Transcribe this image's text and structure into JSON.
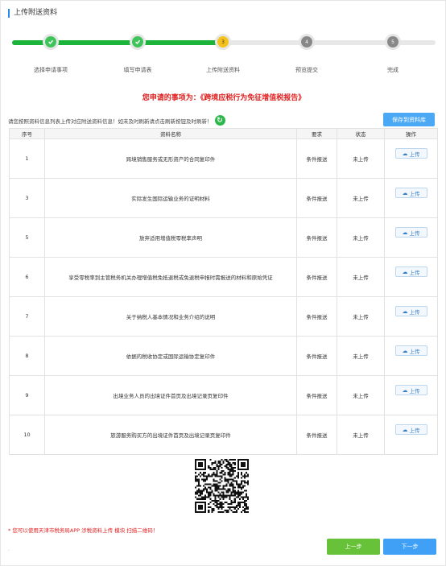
{
  "page": {
    "title": "上传附送资料"
  },
  "steps": [
    {
      "label": "选择申请事项",
      "state": "done",
      "icon": "check-icon"
    },
    {
      "label": "填写申请表",
      "state": "done",
      "icon": "check-icon"
    },
    {
      "label": "上传附送资料",
      "state": "current",
      "num": "3"
    },
    {
      "label": "预览提交",
      "state": "todo",
      "num": "4"
    },
    {
      "label": "完成",
      "state": "todo",
      "num": "5"
    }
  ],
  "matter": "您申请的事项为：《跨境应税行为免征增值税报告》",
  "notice": "请您按照资料信息列表上传对应附送资料信息！如未及时刷新请点击刷新按钮及时刷新！",
  "save_label": "保存到资料库",
  "table": {
    "headers": [
      "序号",
      "资料名称",
      "要求",
      "状态",
      "操作"
    ],
    "upload_label": "上传",
    "rows": [
      {
        "no": "1",
        "name": "跨境销售服务或无形资产的合同复印件",
        "req": "条件报送",
        "status": "未上传"
      },
      {
        "no": "3",
        "name": "实际发生国际运输业务的证明材料",
        "req": "条件报送",
        "status": "未上传"
      },
      {
        "no": "5",
        "name": "放弃适用增值税零税率声明",
        "req": "条件报送",
        "status": "未上传"
      },
      {
        "no": "6",
        "name": "享受零税率到主管税务机关办理增值税免抵退税或免退税申报时需报送的材料和原始凭证",
        "req": "条件报送",
        "status": "未上传"
      },
      {
        "no": "7",
        "name": "关于纳税人基本情况和业务介绍的说明",
        "req": "条件报送",
        "status": "未上传"
      },
      {
        "no": "8",
        "name": "依据的税收协定或国际运输协定复印件",
        "req": "条件报送",
        "status": "未上传"
      },
      {
        "no": "9",
        "name": "出境业务人员的出境证件首页及出境记录页复印件",
        "req": "条件报送",
        "status": "未上传"
      },
      {
        "no": "10",
        "name": "旅游服务购买方的出境证件首页及出境记录页复印件",
        "req": "条件报送",
        "status": "未上传"
      }
    ]
  },
  "tip": "* 您可以使用天津市税务局APP 涉税资料上传 模块 扫描二维码！",
  "buttons": {
    "prev": "上一步",
    "next": "下一步"
  },
  "colors": {
    "done": "#3fc35a",
    "current": "#f4c21c",
    "todo": "#888888",
    "accent": "#3fa0f6",
    "alert": "#e02020"
  }
}
